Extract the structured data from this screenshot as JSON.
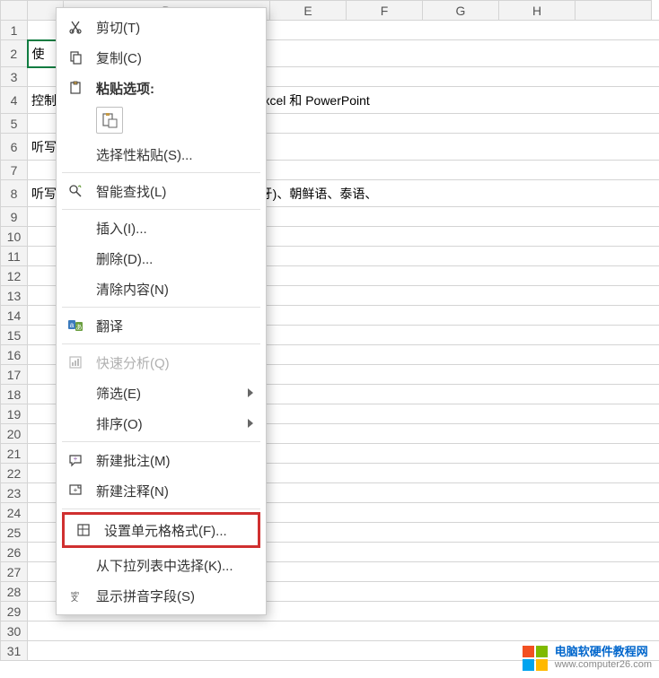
{
  "columns": [
    "",
    "D",
    "E",
    "F",
    "G",
    "H",
    ""
  ],
  "rows": [
    "1",
    "2",
    "3",
    "4",
    "5",
    "6",
    "7",
    "8",
    "9",
    "10",
    "11",
    "12",
    "13",
    "14",
    "15",
    "16",
    "17",
    "18",
    "19",
    "20",
    "21",
    "22",
    "23",
    "24",
    "25",
    "26",
    "27",
    "28",
    "29",
    "30",
    "31"
  ],
  "cells": {
    "A2": "使",
    "A4": "控制",
    "C4": "轻松 @提及通知，并借助 Word、Excel 和 PowerPoint ",
    "A6": "听写",
    "A8": "听写",
    "C8": "语、俄语、波兰语、葡萄牙语(葡萄牙)、朝鲜语、泰语、"
  },
  "menu": {
    "cut": "剪切(T)",
    "copy": "复制(C)",
    "pasteOptionsHeader": "粘贴选项:",
    "pasteSpecial": "选择性粘贴(S)...",
    "smartLookup": "智能查找(L)",
    "insert": "插入(I)...",
    "delete": "删除(D)...",
    "clearContents": "清除内容(N)",
    "translate": "翻译",
    "quickAnalysis": "快速分析(Q)",
    "filter": "筛选(E)",
    "sort": "排序(O)",
    "newComment": "新建批注(M)",
    "newNote": "新建注释(N)",
    "formatCells": "设置单元格格式(F)...",
    "pickFromList": "从下拉列表中选择(K)...",
    "showPhonetic": "显示拼音字段(S)"
  },
  "icons": {
    "cut": "cut-icon",
    "copy": "copy-icon",
    "paste": "paste-icon",
    "clipboard": "clipboard-icon",
    "smartLookup": "smart-lookup-icon",
    "translate": "translate-icon",
    "quickAnalysis": "quick-analysis-icon",
    "comment": "comment-icon",
    "note": "note-icon",
    "formatCells": "format-cells-icon",
    "phonetic": "phonetic-icon"
  },
  "watermark": {
    "line1": "电脑软硬件教程网",
    "line2": "www.computer26.com"
  }
}
